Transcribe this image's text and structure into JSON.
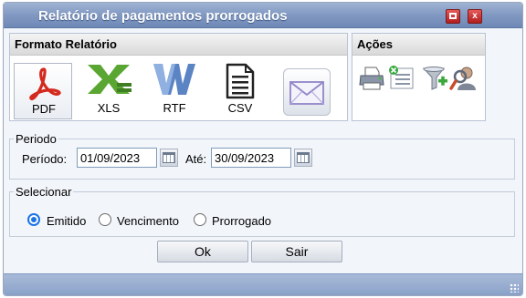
{
  "window": {
    "title": "Relatório de pagamentos prorrogados",
    "maximize_icon": "maximize-icon",
    "close_label": "x"
  },
  "formato": {
    "title": "Formato Relatório",
    "buttons": [
      {
        "label": "PDF",
        "icon": "pdf-icon"
      },
      {
        "label": "XLS",
        "icon": "xls-icon"
      },
      {
        "label": "RTF",
        "icon": "rtf-icon"
      },
      {
        "label": "CSV",
        "icon": "csv-icon"
      },
      {
        "label": "",
        "icon": "envelope-icon"
      }
    ]
  },
  "acoes": {
    "title": "Ações",
    "icons": [
      "printer-icon",
      "clear-list-icon",
      "add-filter-icon",
      "search-user-icon"
    ]
  },
  "periodo": {
    "legend": "Periodo",
    "label_from": "Período:",
    "date_from": "01/09/2023",
    "label_to": "Até:",
    "date_to": "30/09/2023"
  },
  "selecionar": {
    "legend": "Selecionar",
    "options": [
      {
        "label": "Emitido",
        "checked": true
      },
      {
        "label": "Vencimento",
        "checked": false
      },
      {
        "label": "Prorrogado",
        "checked": false
      }
    ]
  },
  "buttons": {
    "ok": "Ok",
    "sair": "Sair"
  },
  "colors": {
    "titlebar": "#8199c2",
    "pdf_red": "#d42a1e",
    "xls_green": "#5aa632",
    "rtf_blue": "#5b84c4",
    "radio_accent": "#1a73e8"
  }
}
